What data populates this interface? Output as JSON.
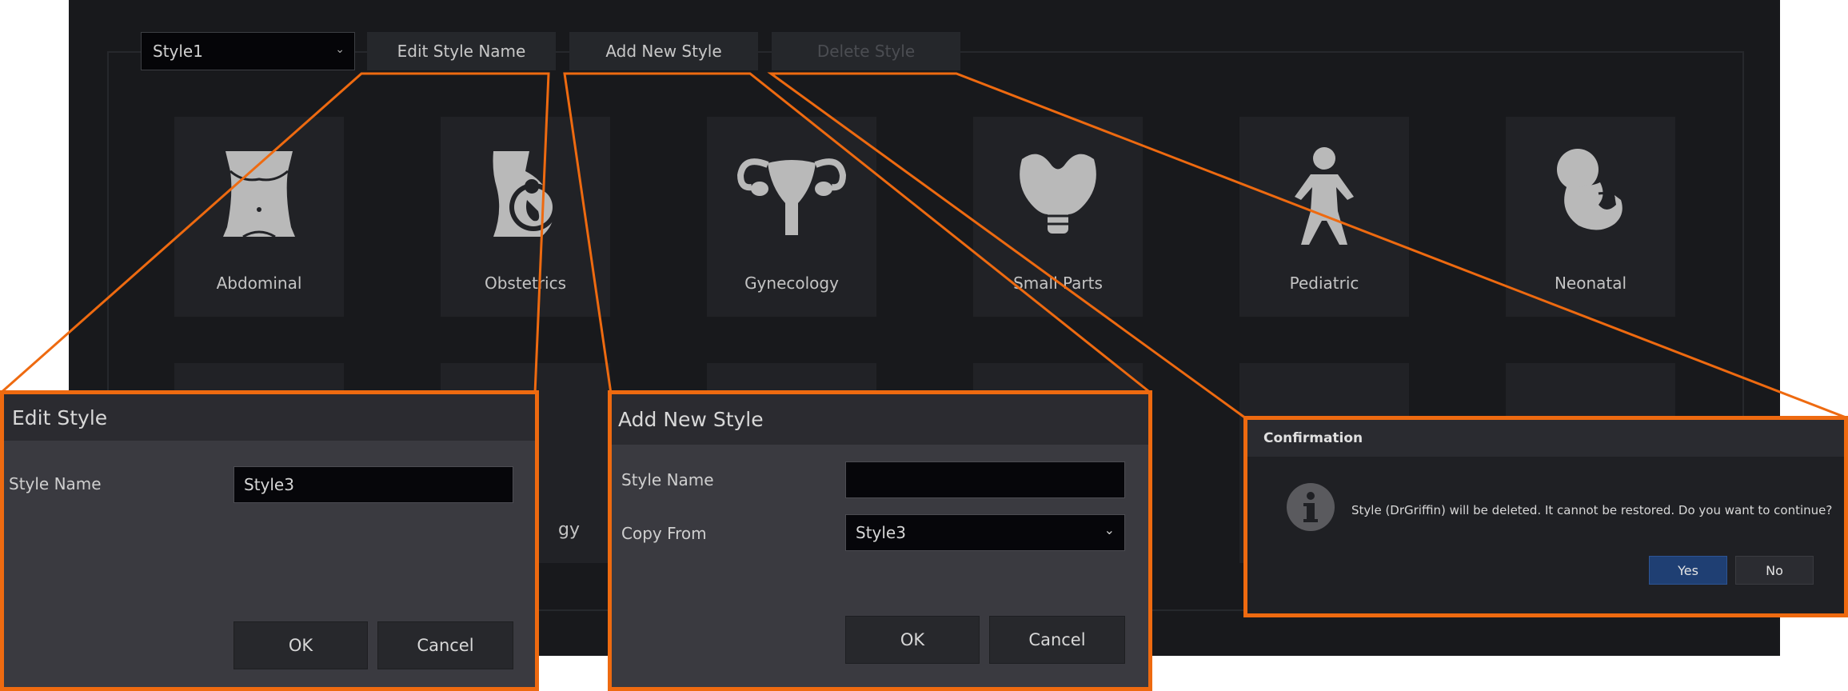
{
  "toolbar": {
    "style_select_value": "Style1",
    "edit_style_name_label": "Edit Style Name",
    "add_new_style_label": "Add New Style",
    "delete_style_label": "Delete Style"
  },
  "presets": [
    {
      "label": "Abdominal",
      "icon": "abdomen-icon"
    },
    {
      "label": "Obstetrics",
      "icon": "pregnancy-icon"
    },
    {
      "label": "Gynecology",
      "icon": "uterus-icon"
    },
    {
      "label": "Small Parts",
      "icon": "thyroid-icon"
    },
    {
      "label": "Pediatric",
      "icon": "child-icon"
    },
    {
      "label": "Neonatal",
      "icon": "fetus-icon"
    }
  ],
  "row2_partial_label": "gy",
  "edit_dialog": {
    "title": "Edit Style",
    "style_name_label": "Style Name",
    "style_name_value": "Style3",
    "ok_label": "OK",
    "cancel_label": "Cancel"
  },
  "add_dialog": {
    "title": "Add New Style",
    "style_name_label": "Style Name",
    "style_name_value": "",
    "copy_from_label": "Copy From",
    "copy_from_value": "Style3",
    "ok_label": "OK",
    "cancel_label": "Cancel"
  },
  "confirm_dialog": {
    "title": "Confirmation",
    "message": "Style (DrGriffin) will be deleted. It cannot be restored. Do you want to continue?",
    "yes_label": "Yes",
    "no_label": "No",
    "icon": "info-icon"
  },
  "colors": {
    "callout": "#ee6a10",
    "app_background": "#18191c",
    "tile_background": "#212226",
    "yes_button": "#1f3f73"
  }
}
